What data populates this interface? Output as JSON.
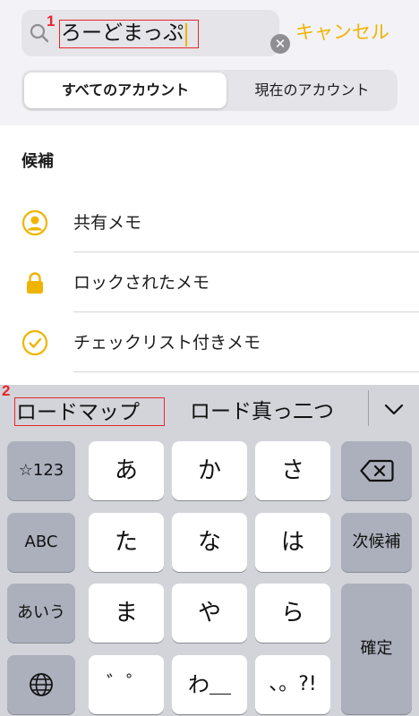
{
  "search": {
    "query": "ろーどまっぷ",
    "cancel_label": "キャンセル",
    "marker_1": "1"
  },
  "segmented": {
    "active": "すべてのアカウント",
    "inactive": "現在のアカウント"
  },
  "suggestions": {
    "title": "候補",
    "items": [
      {
        "label": "共有メモ",
        "icon": "person-circle-icon"
      },
      {
        "label": "ロックされたメモ",
        "icon": "lock-icon"
      },
      {
        "label": "チェックリスト付きメモ",
        "icon": "checkmark-circle-icon"
      }
    ]
  },
  "keyboard": {
    "candidates": [
      "ロードマップ",
      "ロード真っ二つ"
    ],
    "marker_2": "2",
    "rows": [
      {
        "left": "☆123",
        "keys": [
          "あ",
          "か",
          "さ"
        ],
        "right": "delete-icon"
      },
      {
        "left": "ABC",
        "keys": [
          "た",
          "な",
          "は"
        ],
        "right": "次候補"
      },
      {
        "left": "あいう",
        "keys": [
          "ま",
          "や",
          "ら"
        ],
        "right": "確定"
      },
      {
        "left": "globe-icon",
        "keys": [
          "゛゜",
          "わ＿",
          "、。?!"
        ]
      }
    ]
  },
  "colors": {
    "accent": "#f0b400",
    "highlight_box": "#e8262a",
    "keyboard_bg": "#d2d4da"
  }
}
